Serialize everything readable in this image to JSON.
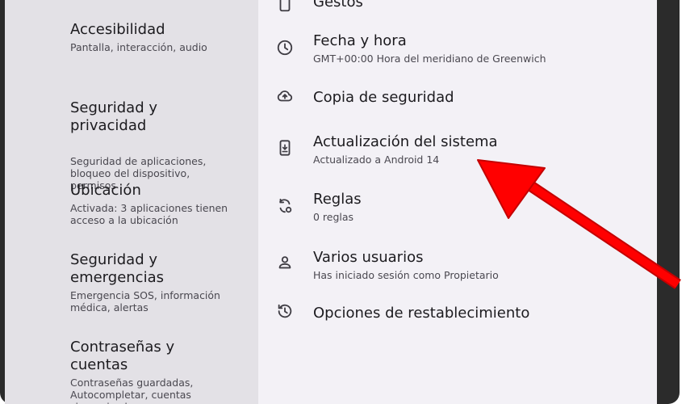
{
  "left_menu": {
    "items": [
      {
        "title": "Accesibilidad",
        "sub": "Pantalla, interacción, audio"
      },
      {
        "title": "Seguridad y\nprivacidad",
        "sub": "Seguridad de aplicaciones,\nbloqueo del dispositivo,\npermisos"
      },
      {
        "title": "Ubicación",
        "sub": "Activada: 3 aplicaciones tienen\nacceso a la ubicación"
      },
      {
        "title": "Seguridad y\nemergencias",
        "sub": "Emergencia SOS, información\nmédica, alertas"
      },
      {
        "title": "Contraseñas y\ncuentas",
        "sub": "Contraseñas guardadas,\nAutocompletar, cuentas\nsincronizadas"
      }
    ]
  },
  "right_menu": {
    "items": [
      {
        "title": "Gestos",
        "sub": "",
        "icon": "gestures-icon"
      },
      {
        "title": "Fecha y hora",
        "sub": "GMT+00:00 Hora del meridiano de Greenwich",
        "icon": "clock-icon"
      },
      {
        "title": "Copia de seguridad",
        "sub": "",
        "icon": "cloud-upload-icon"
      },
      {
        "title": "Actualización del sistema",
        "sub": "Actualizado a Android 14",
        "icon": "system-update-icon"
      },
      {
        "title": "Reglas",
        "sub": "0 reglas",
        "icon": "rules-icon"
      },
      {
        "title": "Varios usuarios",
        "sub": "Has iniciado sesión como Propietario",
        "icon": "person-icon"
      },
      {
        "title": "Opciones de restablecimiento",
        "sub": "",
        "icon": "history-icon"
      }
    ]
  },
  "colors": {
    "left_bg": "#e3e1e6",
    "right_bg": "#f3f1f6",
    "arrow": "#ff0000"
  }
}
